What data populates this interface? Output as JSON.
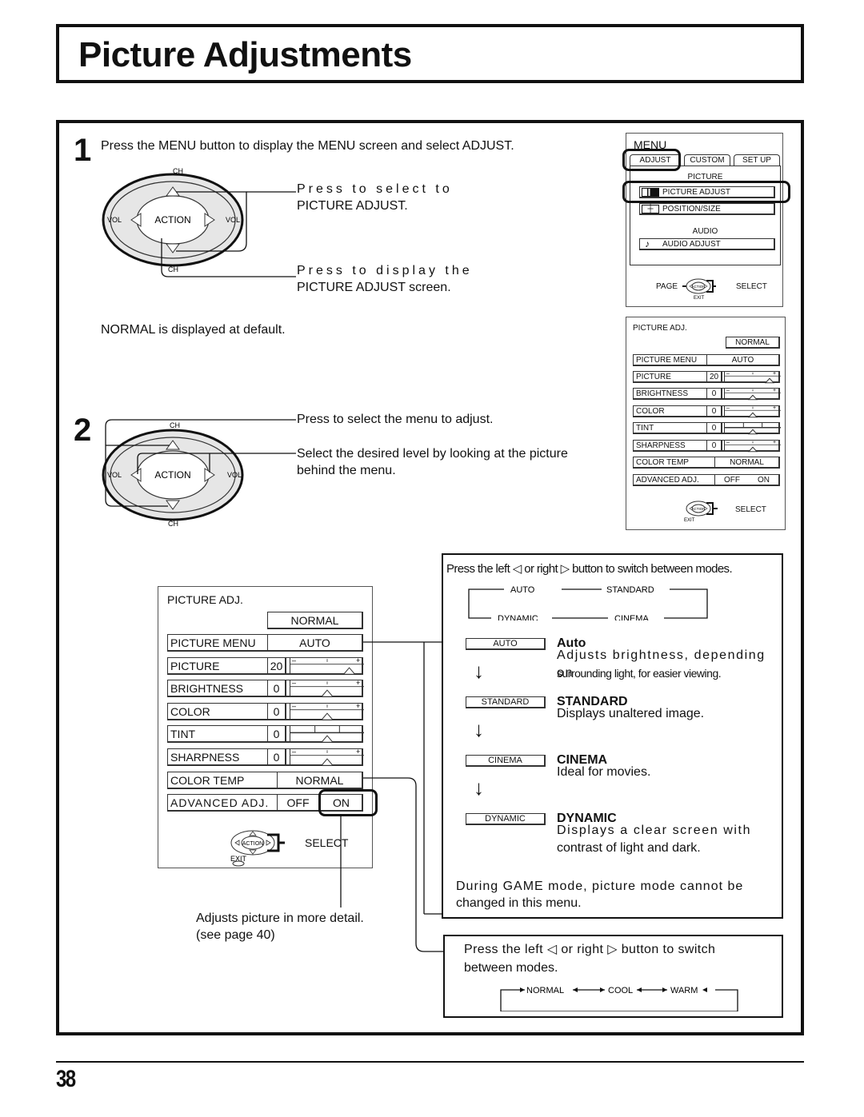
{
  "page": {
    "title": "Picture Adjustments",
    "page_number": "38"
  },
  "step1": {
    "number": "1",
    "instruction": "Press the MENU button to display the MENU screen and select  ADJUST.",
    "callout_select_line1": "Press to select to",
    "callout_select_line2": "PICTURE ADJUST.",
    "callout_display_line1": "Press to display the",
    "callout_display_line2": "PICTURE ADJUST screen.",
    "default_note": "NORMAL is displayed at default."
  },
  "step2": {
    "number": "2",
    "callout_select": "Press to select the menu to adjust.",
    "callout_level_line1": "Select the desired level by looking at the picture",
    "callout_level_line2": "behind the menu."
  },
  "remote": {
    "ch_top": "CH",
    "ch_bottom": "CH",
    "vol_left": "VOL",
    "vol_right": "VOL",
    "action": "ACTION"
  },
  "menu_screen": {
    "title": "MENU",
    "tabs": [
      "ADJUST",
      "CUSTOM",
      "SET  UP"
    ],
    "selected_tab": "ADJUST",
    "section_picture": "PICTURE",
    "items": [
      {
        "icon": "picture-adjust-icon",
        "label": "PICTURE  ADJUST"
      },
      {
        "icon": "position-size-icon",
        "label": "POSITION/SIZE"
      }
    ],
    "section_audio": "AUDIO",
    "audio_items": [
      {
        "icon": "music-note-icon",
        "label": "AUDIO  ADJUST"
      }
    ],
    "footer_page": "PAGE",
    "footer_action": "ACTION",
    "footer_select": "SELECT",
    "footer_exit": "EXIT"
  },
  "picture_adj": {
    "title": "PICTURE ADJ.",
    "preset": "NORMAL",
    "picture_menu_label": "PICTURE  MENU",
    "picture_menu_value": "AUTO",
    "sliders": [
      {
        "label": "PICTURE",
        "value": "20",
        "position_fraction": 0.8,
        "type": "range"
      },
      {
        "label": "BRIGHTNESS",
        "value": "0",
        "position_fraction": 0.5,
        "type": "range"
      },
      {
        "label": "COLOR",
        "value": "0",
        "position_fraction": 0.5,
        "type": "range"
      },
      {
        "label": "TINT",
        "value": "0",
        "position_fraction": 0.5,
        "type": "tint"
      },
      {
        "label": "SHARPNESS",
        "value": "0",
        "position_fraction": 0.5,
        "type": "range"
      }
    ],
    "slider_min_symbol": "–",
    "slider_max_symbol": "+",
    "color_temp_label": "COLOR  TEMP",
    "color_temp_value": "NORMAL",
    "advanced_label": "ADVANCED ADJ.",
    "advanced_off": "OFF",
    "advanced_on": "ON",
    "footer_action": "ACTION",
    "footer_select": "SELECT",
    "footer_exit": "EXIT"
  },
  "modes_panel": {
    "header": "Press the left ◁ or right ▷ button to switch between modes.",
    "cycle": [
      "AUTO",
      "STANDARD",
      "CINEMA",
      "DYNAMIC"
    ],
    "modes": [
      {
        "box": "AUTO",
        "title": "Auto",
        "desc_line1": "Adjusts brightness, depending on",
        "desc_line2": "surrounding light, for easier viewing."
      },
      {
        "box": "STANDARD",
        "title": "STANDARD",
        "desc_line1": "Displays unaltered image.",
        "desc_line2": ""
      },
      {
        "box": "CINEMA",
        "title": "CINEMA",
        "desc_line1": "Ideal for movies.",
        "desc_line2": ""
      },
      {
        "box": "DYNAMIC",
        "title": "DYNAMIC",
        "desc_line1": "Displays a clear screen with",
        "desc_line2": "contrast of light and dark."
      }
    ],
    "note_line1": "During GAME mode, picture mode cannot be",
    "note_line2": "changed in this menu."
  },
  "advanced_note": {
    "line1": "Adjusts picture in more detail.",
    "line2": "(see page 40)"
  },
  "color_temp_panel": {
    "line1": "Press the left ◁ or right ▷ button to switch",
    "line2": "between modes.",
    "cycle": [
      "NORMAL",
      "COOL",
      "WARM"
    ]
  }
}
